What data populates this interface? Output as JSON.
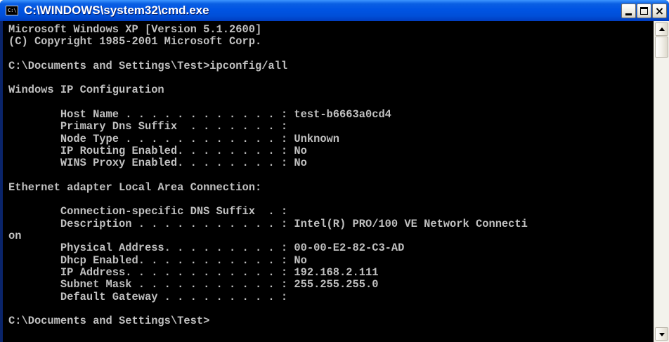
{
  "window": {
    "title": "C:\\WINDOWS\\system32\\cmd.exe",
    "icon_label": "C:\\",
    "icon": "console-icon",
    "buttons": {
      "minimize": "minimize-icon",
      "maximize": "maximize-icon",
      "close_symbol": "×"
    }
  },
  "console": {
    "lines": [
      "Microsoft Windows XP [Version 5.1.2600]",
      "(C) Copyright 1985-2001 Microsoft Corp.",
      "",
      "C:\\Documents and Settings\\Test>ipconfig/all",
      "",
      "Windows IP Configuration",
      "",
      "        Host Name . . . . . . . . . . . . : test-b6663a0cd4",
      "        Primary Dns Suffix  . . . . . . . :",
      "        Node Type . . . . . . . . . . . . : Unknown",
      "        IP Routing Enabled. . . . . . . . : No",
      "        WINS Proxy Enabled. . . . . . . . : No",
      "",
      "Ethernet adapter Local Area Connection:",
      "",
      "        Connection-specific DNS Suffix  . :",
      "        Description . . . . . . . . . . . : Intel(R) PRO/100 VE Network Connecti",
      "on",
      "        Physical Address. . . . . . . . . : 00-00-E2-82-C3-AD",
      "        Dhcp Enabled. . . . . . . . . . . : No",
      "        IP Address. . . . . . . . . . . . : 192.168.2.111",
      "        Subnet Mask . . . . . . . . . . . : 255.255.255.0",
      "        Default Gateway . . . . . . . . . :",
      "",
      "C:\\Documents and Settings\\Test>"
    ]
  },
  "colors": {
    "titlebar": "#0054e3",
    "console_background": "#000000",
    "console_text": "#c0c0c0"
  }
}
